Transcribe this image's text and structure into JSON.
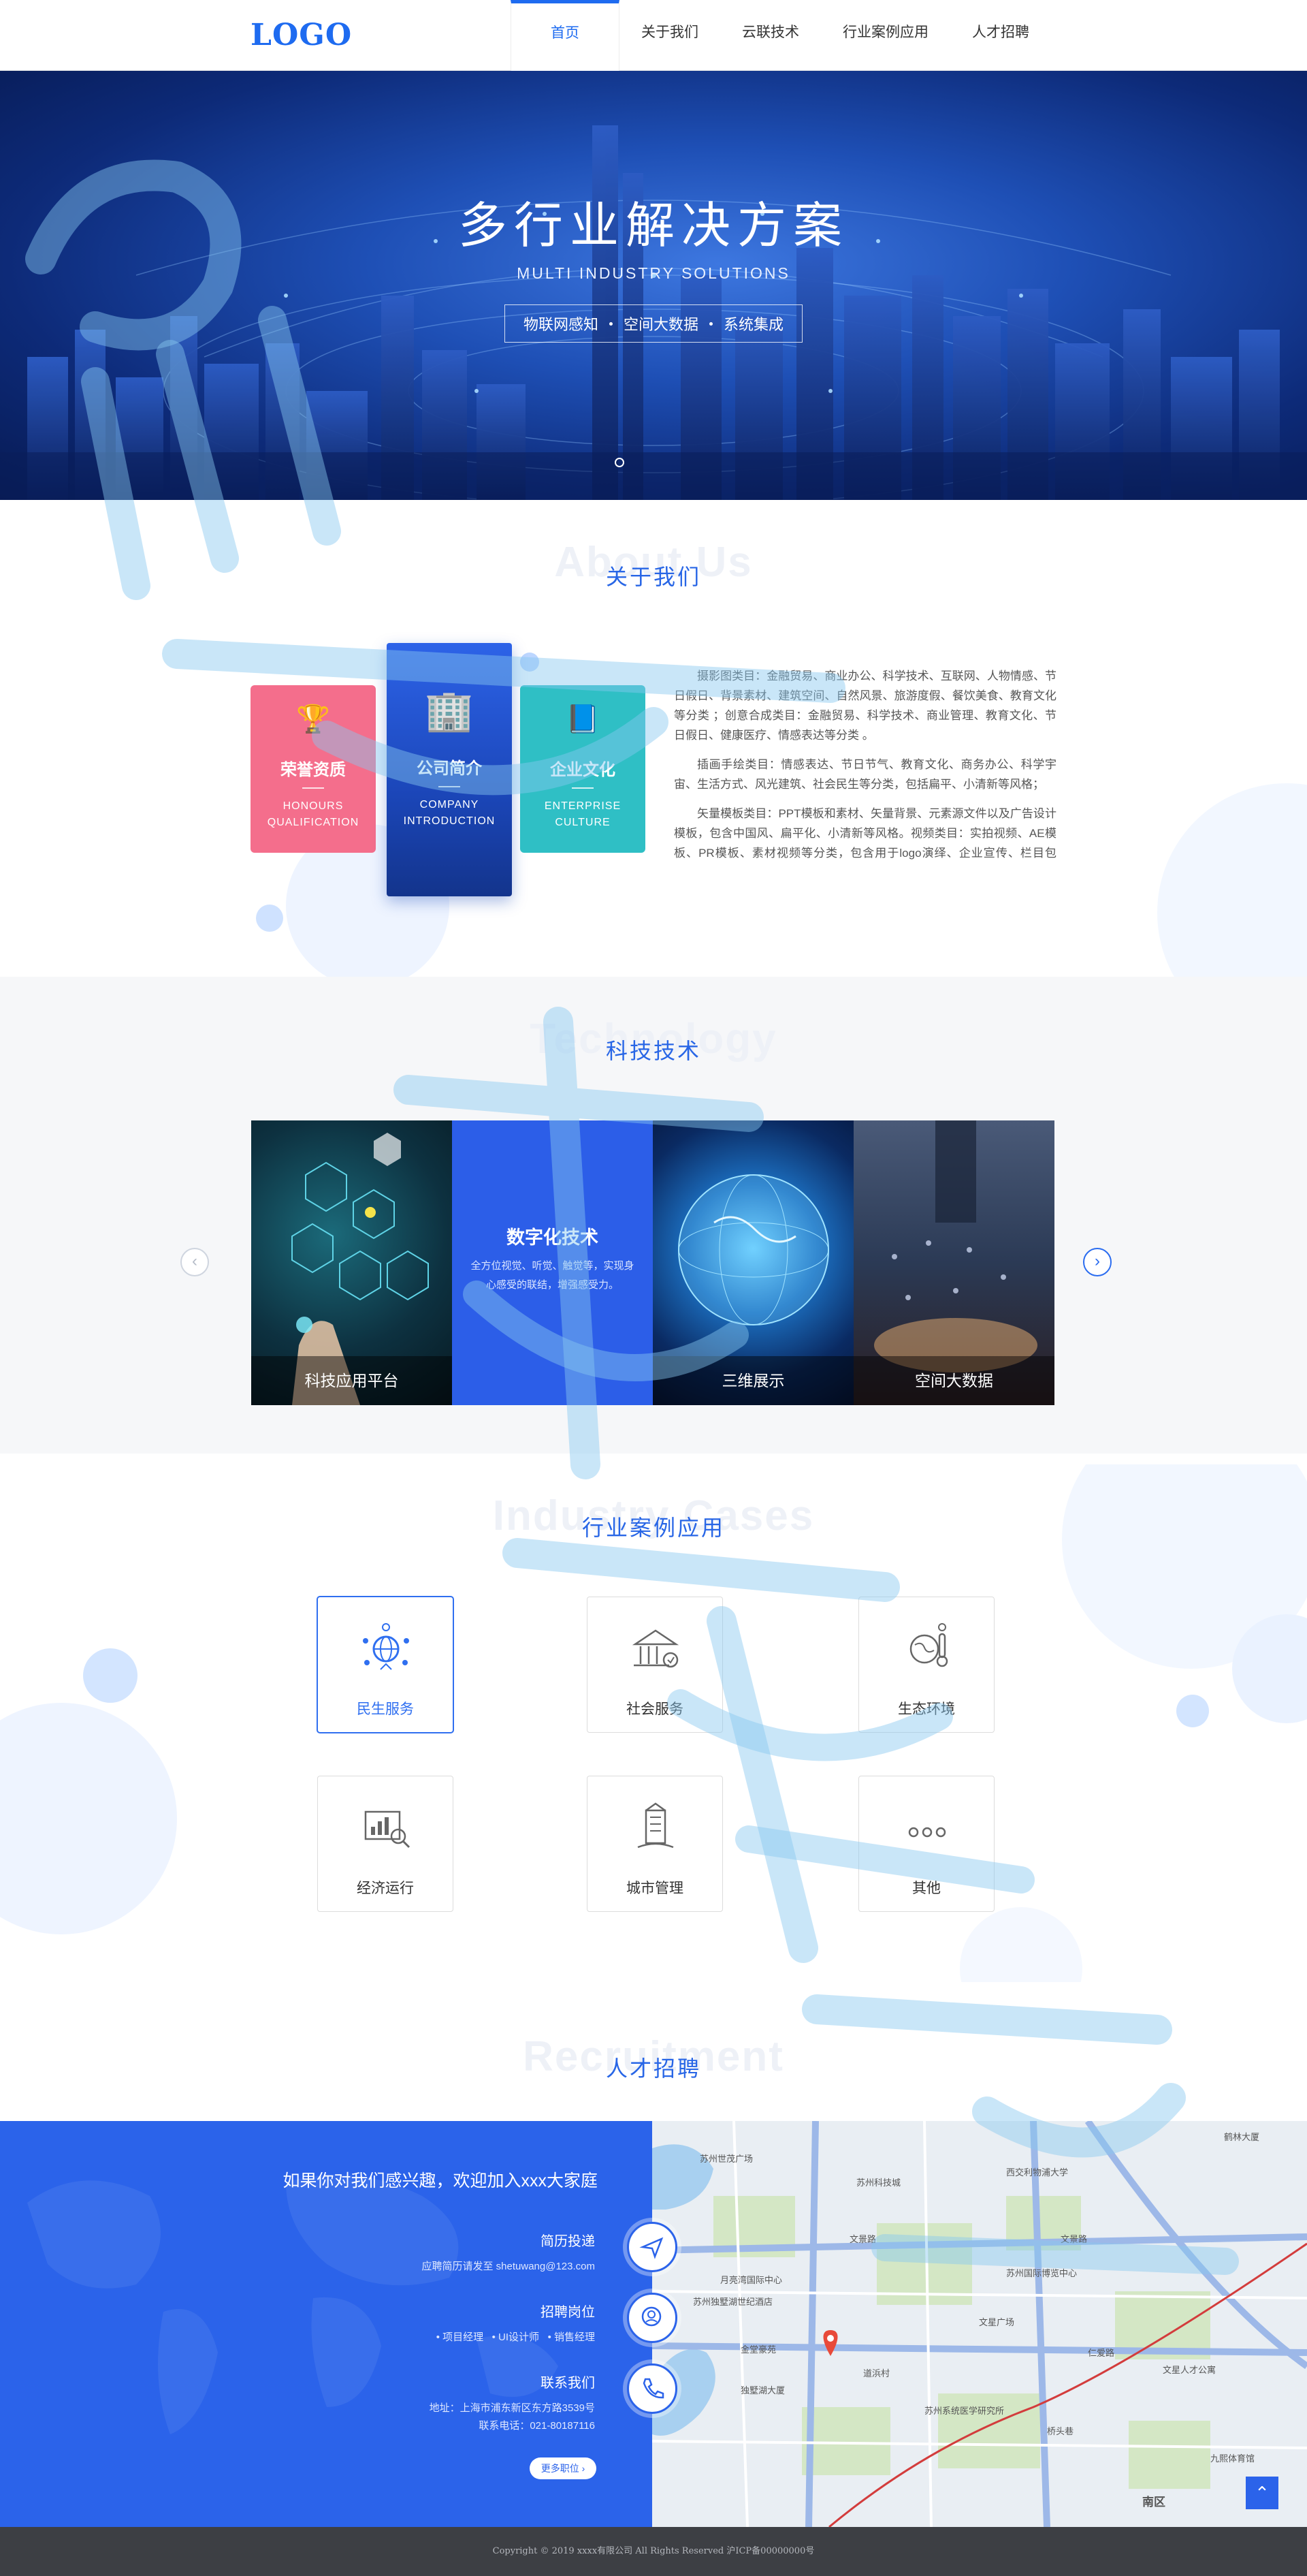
{
  "header": {
    "logo": "LOGO",
    "nav": [
      "首页",
      "关于我们",
      "云联技术",
      "行业案例应用",
      "人才招聘"
    ]
  },
  "hero": {
    "title": "多行业解决方案",
    "subtitle": "MULTI  INDUSTRY  SOLUTIONS",
    "tags": [
      "物联网感知",
      "空间大数据",
      "系统集成"
    ]
  },
  "about": {
    "bg_title": "About Us",
    "title": "关于我们",
    "cards": [
      {
        "title": "荣誉资质",
        "en1": "HONOURS",
        "en2": "QUALIFICATION"
      },
      {
        "title": "公司简介",
        "en1": "COMPANY",
        "en2": "INTRODUCTION"
      },
      {
        "title": "企业文化",
        "en1": "ENTERPRISE",
        "en2": "CULTURE"
      }
    ],
    "paragraphs": [
      "摄影图类目：金融贸易、商业办公、科学技术、互联网、人物情感、节日假日、背景素材、建筑空间、自然风景、旅游度假、餐饮美食、教育文化等分类 ；创意合成类目：金融贸易、科学技术、商业管理、教育文化、节日假日、健康医疗、情感表达等分类 。",
      "插画手绘类目：情感表达、节日节气、教育文化、商务办公、科学宇宙、生活方式、风光建筑、社会民生等分类，包括扁平、小清新等风格；",
      "矢量模板类目：PPT模板和素材、矢量背景、元素源文件以及广告设计模板，包含中国风、扁平化、小清新等风格。视频类目：实拍视频、AE模板、PR模板、素材视频等分类，包含用于logo演绎、企业宣传、栏目包装、政府机关等不同用途的模板，涉及唯美、可爱、震撼、"
    ]
  },
  "tech": {
    "bg_title": "Technology",
    "title": "科技技术",
    "items": [
      {
        "caption": "科技应用平台"
      },
      {
        "title": "数字化技术",
        "desc": "全方位视觉、听觉、触觉等，实现身心感受的联结，增强感受力。"
      },
      {
        "caption": "三维展示"
      },
      {
        "caption": "空间大数据"
      }
    ],
    "arrow_left": "‹",
    "arrow_right": "›"
  },
  "cases": {
    "bg_title": "Industry Cases",
    "title": "行业案例应用",
    "items": [
      "民生服务",
      "社会服务",
      "生态环境",
      "经济运行",
      "城市管理",
      "其他"
    ]
  },
  "recruit": {
    "bg_title": "Recruitment",
    "title": "人才招聘",
    "headline": "如果你对我们感兴趣，欢迎加入xxx大家庭",
    "resume": {
      "title": "简历投递",
      "detail": "应聘简历请发至 shetuwang@123.com"
    },
    "positions": {
      "title": "招聘岗位",
      "items": [
        "项目经理",
        "UI设计师",
        "销售经理"
      ]
    },
    "contact": {
      "title": "联系我们",
      "address": "地址：上海市浦东新区东方路3539号",
      "phone": "联系电话：021-80187116"
    },
    "more": "更多职位 ›",
    "map_labels": [
      "苏州世茂广场",
      "苏州科技城",
      "文景路",
      "月亮湾国际中心",
      "苏州独墅湖世纪酒店",
      "金堂豪苑",
      "独墅湖大厦",
      "南区",
      "西交利物浦大学",
      "苏州国际博览中心",
      "仁爱路",
      "九熙体育馆",
      "道浜村",
      "苏州系统医学研究所",
      "文星广场",
      "桥头巷",
      "文星人才公寓",
      "文景路",
      "鹤林大厦"
    ]
  },
  "back_top": "⌃",
  "footer": {
    "copyright": "Copyright © 2019 xxxx有限公司 All Rights Reserved 沪ICP备00000000号"
  },
  "colors": {
    "primary": "#2b63ea",
    "accent_pink": "#f46e8c",
    "accent_teal": "#2fbfc5"
  }
}
